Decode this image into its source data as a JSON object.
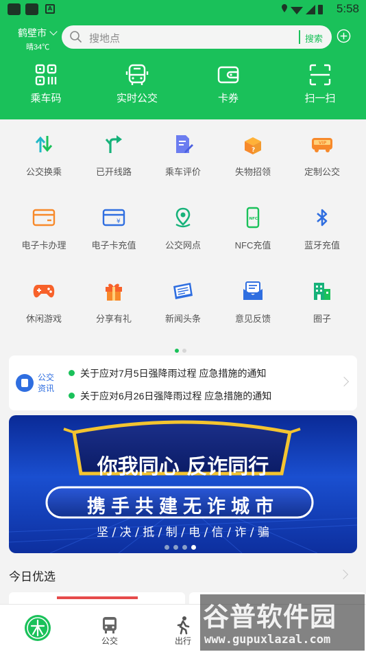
{
  "status_bar": {
    "time": "5:58"
  },
  "header": {
    "city": "鹤壁市",
    "weather": "晴34℃",
    "search_placeholder": "搜地点",
    "search_button": "搜索",
    "accent_color": "#1ac15a"
  },
  "top_nav": [
    {
      "label": "乘车码",
      "icon": "qr-code-icon"
    },
    {
      "label": "实时公交",
      "icon": "bus-front-icon"
    },
    {
      "label": "卡券",
      "icon": "wallet-icon"
    },
    {
      "label": "扫一扫",
      "icon": "scan-icon"
    }
  ],
  "grid": [
    {
      "label": "公交换乘",
      "icon": "transfer-arrows-icon"
    },
    {
      "label": "已开线路",
      "icon": "route-fork-icon"
    },
    {
      "label": "乘车评价",
      "icon": "review-edit-icon"
    },
    {
      "label": "失物招领",
      "icon": "lost-found-box-icon"
    },
    {
      "label": "定制公交",
      "icon": "vip-bus-icon"
    },
    {
      "label": "电子卡办理",
      "icon": "card-apply-icon"
    },
    {
      "label": "电子卡充值",
      "icon": "card-recharge-icon"
    },
    {
      "label": "公交网点",
      "icon": "location-pin-icon"
    },
    {
      "label": "NFC充值",
      "icon": "nfc-phone-icon"
    },
    {
      "label": "蓝牙充值",
      "icon": "bluetooth-icon"
    },
    {
      "label": "休闲游戏",
      "icon": "gamepad-icon"
    },
    {
      "label": "分享有礼",
      "icon": "gift-icon"
    },
    {
      "label": "新闻头条",
      "icon": "newspaper-icon"
    },
    {
      "label": "意见反馈",
      "icon": "feedback-mail-icon"
    },
    {
      "label": "圈子",
      "icon": "buildings-icon"
    }
  ],
  "news": {
    "tag_line1": "公交",
    "tag_line2": "资讯",
    "items": [
      "关于应对7月5日强降雨过程 应急措施的通知",
      "关于应对6月26日强降雨过程 应急措施的通知"
    ]
  },
  "banner": {
    "title": "你我同心 反诈同行",
    "subtitle": "携手共建无诈城市",
    "tagline": "坚 / 决 / 抵 / 制 / 电 / 信 / 诈 / 骗"
  },
  "section_title": "今日优选",
  "tabbar": [
    {
      "label": "",
      "icon": "home-logo-icon"
    },
    {
      "label": "公交",
      "icon": "bus-tab-icon"
    },
    {
      "label": "出行",
      "icon": "walking-person-icon"
    }
  ],
  "watermark": {
    "line1": "谷普软件园",
    "line2": "www.gupuxlazal.com"
  }
}
